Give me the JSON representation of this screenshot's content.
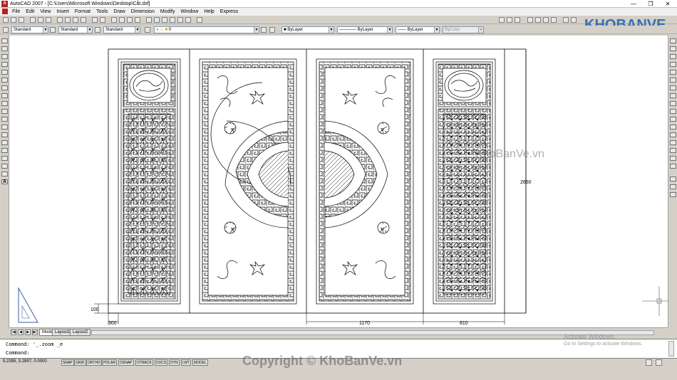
{
  "window": {
    "title": "AutoCAD 2007 - [C:\\Users\\Microsoft Windows\\Desktop\\Cắt.dxf]",
    "minimize_glyph": "—",
    "restore_glyph": "❐",
    "close_glyph": "✕"
  },
  "menu": [
    "File",
    "Edit",
    "View",
    "Insert",
    "Format",
    "Tools",
    "Draw",
    "Dimension",
    "Modify",
    "Window",
    "Help",
    "Express"
  ],
  "styles_toolbar": {
    "text_style": "Standard",
    "dim_style": "Standard",
    "table_style": "Standard"
  },
  "layer_toolbar": {
    "layer": "0"
  },
  "properties_toolbar": {
    "color": "ByLayer",
    "linetype": "ByLayer",
    "lineweight": "ByLayer",
    "plotstyle": "ByColor"
  },
  "drawing": {
    "dim_height": "2650",
    "dim_base": "100",
    "dim_left": "300",
    "dim_middle": "1170",
    "dim_right": "810",
    "watermark": "KhoBanVe.vn"
  },
  "brand_logo": "KHOBANVE",
  "layout_tabs": [
    "Model",
    "Layout1",
    "Layout2"
  ],
  "active_tab": "Model",
  "command_lines": [
    "Command: '_.zoom _e",
    "Command:"
  ],
  "status": {
    "coords": "5.2395, 3.2897, 0.0000",
    "toggles": [
      "SNAP",
      "GRID",
      "ORTHO",
      "POLAR",
      "OSNAP",
      "OTRACK",
      "DUCS",
      "DYN",
      "LWT",
      "MODEL"
    ]
  },
  "activation": {
    "title": "Activate Windows",
    "subtitle": "Go to Settings to activate Windows."
  },
  "copyright_watermark": "Copyright © KhoBanVe.vn",
  "colors": {
    "canvas": "#ffffff",
    "chrome": "#d4d0c8",
    "lines": "#000000",
    "brand": "#3a6fb0"
  }
}
